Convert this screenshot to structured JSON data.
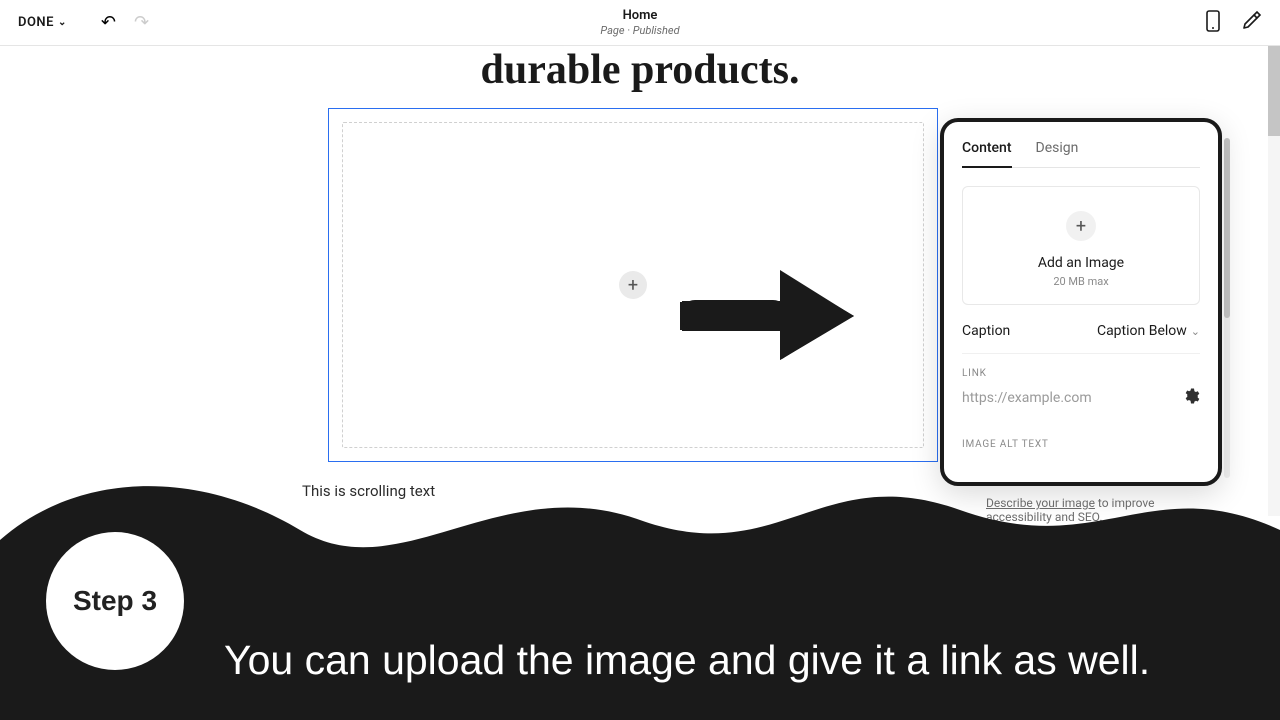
{
  "topbar": {
    "done_label": "DONE",
    "page_title": "Home",
    "page_subtitle": "Page · Published"
  },
  "canvas": {
    "heading_text": "durable products.",
    "scrolling_text": "This is scrolling text"
  },
  "popover": {
    "tabs": {
      "content": "Content",
      "design": "Design"
    },
    "add_image": {
      "label": "Add an Image",
      "sub": "20 MB max"
    },
    "caption": {
      "label": "Caption",
      "value": "Caption Below"
    },
    "link": {
      "section": "LINK",
      "placeholder": "https://example.com"
    },
    "alt": {
      "section": "IMAGE ALT TEXT"
    },
    "describe": {
      "underlined": "Describe your image",
      "rest": " to improve accessibility and SEO."
    }
  },
  "overlay": {
    "step_label": "Step 3",
    "step_text": "You can upload the image and give it a link as well."
  }
}
